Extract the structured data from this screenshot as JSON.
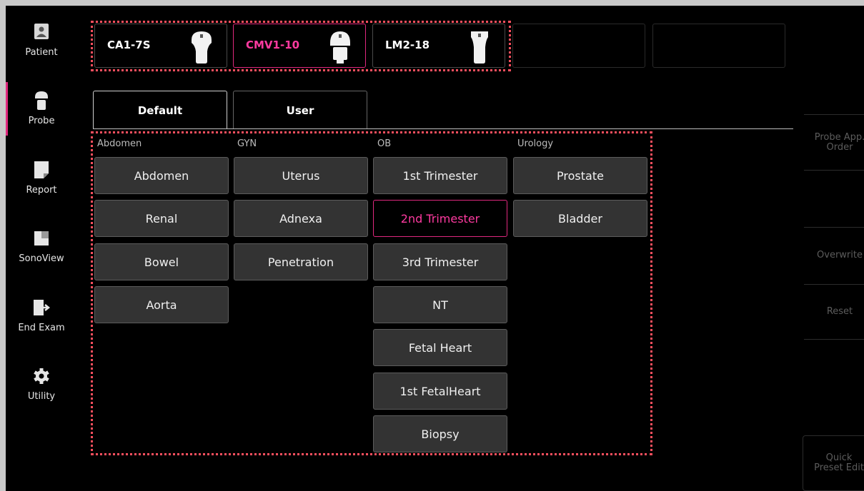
{
  "nav": {
    "items": [
      {
        "label": "Patient",
        "icon": "patient-icon"
      },
      {
        "label": "Probe",
        "icon": "probe-icon"
      },
      {
        "label": "Report",
        "icon": "report-icon"
      },
      {
        "label": "SonoView",
        "icon": "sonoview-icon"
      },
      {
        "label": "End Exam",
        "icon": "end-exam-icon"
      },
      {
        "label": "Utility",
        "icon": "gear-icon"
      }
    ],
    "active": "Probe"
  },
  "probes": [
    {
      "label": "CA1-7S",
      "icon": "convex-probe-icon"
    },
    {
      "label": "CMV1-10",
      "icon": "volume-probe-icon",
      "active": true
    },
    {
      "label": "LM2-18",
      "icon": "linear-probe-icon"
    }
  ],
  "tabs": [
    {
      "label": "Default",
      "active": true
    },
    {
      "label": "User"
    }
  ],
  "categories": [
    {
      "name": "Abdomen",
      "presets": [
        "Abdomen",
        "Renal",
        "Bowel",
        "Aorta"
      ]
    },
    {
      "name": "GYN",
      "presets": [
        "Uterus",
        "Adnexa",
        "Penetration"
      ]
    },
    {
      "name": "OB",
      "presets": [
        "1st Trimester",
        "2nd Trimester",
        "3rd Trimester",
        "NT",
        "Fetal Heart",
        "1st FetalHeart",
        "Biopsy"
      ]
    },
    {
      "name": "Urology",
      "presets": [
        "Prostate",
        "Bladder"
      ]
    }
  ],
  "active_preset": "2nd Trimester",
  "side_panel": {
    "probe_app_order_line1": "Probe App.",
    "probe_app_order_line2": "Order",
    "overwrite": "Overwrite",
    "reset": "Reset",
    "quick_preset_edit_line1": "Quick",
    "quick_preset_edit_line2": "Preset Edit"
  },
  "colors": {
    "accent": "#e0287e",
    "highlight_outline": "#ff4f5e",
    "button_bg": "#333333"
  }
}
